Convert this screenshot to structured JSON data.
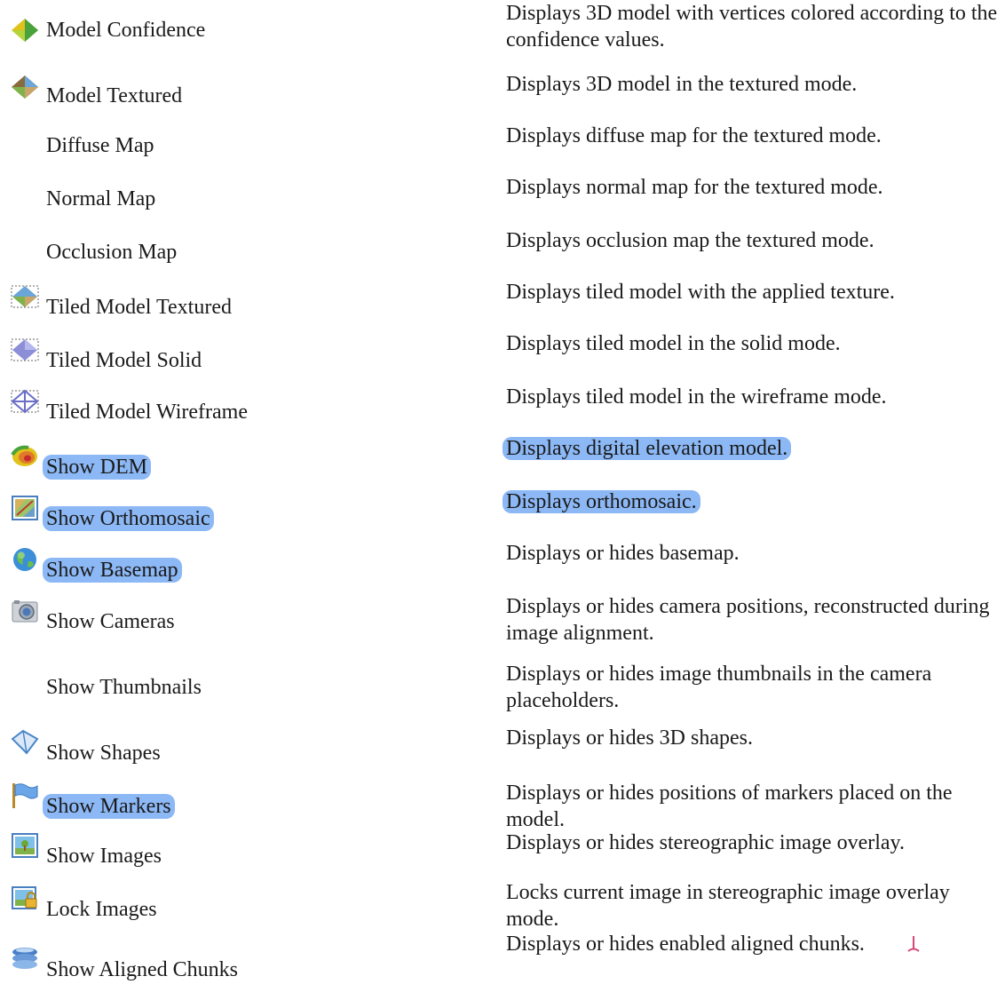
{
  "rows": [
    {
      "name": "Model Confidence",
      "desc": "Displays 3D model with vertices colored according to the confidence values.",
      "icon": "model-confidence-icon"
    },
    {
      "name": "Model Textured",
      "desc": "Displays 3D model in the textured mode.",
      "icon": "model-textured-icon"
    },
    {
      "name": "Diffuse Map",
      "desc": "Displays diffuse map for the textured mode."
    },
    {
      "name": "Normal Map",
      "desc": "Displays normal map for the textured mode."
    },
    {
      "name": "Occlusion Map",
      "desc": "Displays occlusion map the textured mode."
    },
    {
      "name": "Tiled Model Textured",
      "desc": "Displays tiled model with the applied texture.",
      "icon": "tiled-model-textured-icon"
    },
    {
      "name": "Tiled Model Solid",
      "desc": "Displays tiled model in the solid mode.",
      "icon": "tiled-model-solid-icon"
    },
    {
      "name": "Tiled Model Wireframe",
      "desc": "Displays tiled model in the wireframe mode.",
      "icon": "tiled-model-wireframe-icon"
    },
    {
      "name": "Show DEM",
      "desc": "Displays digital elevation model.",
      "icon": "dem-icon"
    },
    {
      "name": "Show Orthomosaic",
      "desc": "Displays orthomosaic.",
      "icon": "orthomosaic-icon"
    },
    {
      "name": "Show Basemap",
      "desc": "Displays or hides basemap.",
      "icon": "basemap-globe-icon"
    },
    {
      "name": "Show Cameras",
      "desc": "Displays or hides camera positions, reconstructed during image alignment.",
      "icon": "camera-icon"
    },
    {
      "name": "Show Thumbnails",
      "desc": "Displays or hides image thumbnails in the camera placeholders."
    },
    {
      "name": "Show Shapes",
      "desc": "Displays or hides 3D shapes.",
      "icon": "shapes-icon"
    },
    {
      "name": "Show Markers",
      "desc": "Displays or hides positions of markers placed on the model.",
      "icon": "marker-flag-icon"
    },
    {
      "name": "Show Images",
      "desc": "Displays or hides stereographic image overlay.",
      "icon": "image-icon"
    },
    {
      "name": "Lock Images",
      "desc": "Locks current image in stereographic image overlay mode.",
      "icon": "lock-image-icon"
    },
    {
      "name": "Show Aligned Chunks",
      "desc": "Displays or hides enabled aligned chunks.",
      "icon": "aligned-chunks-icon"
    }
  ],
  "highlight_color": "#8cb8f5"
}
